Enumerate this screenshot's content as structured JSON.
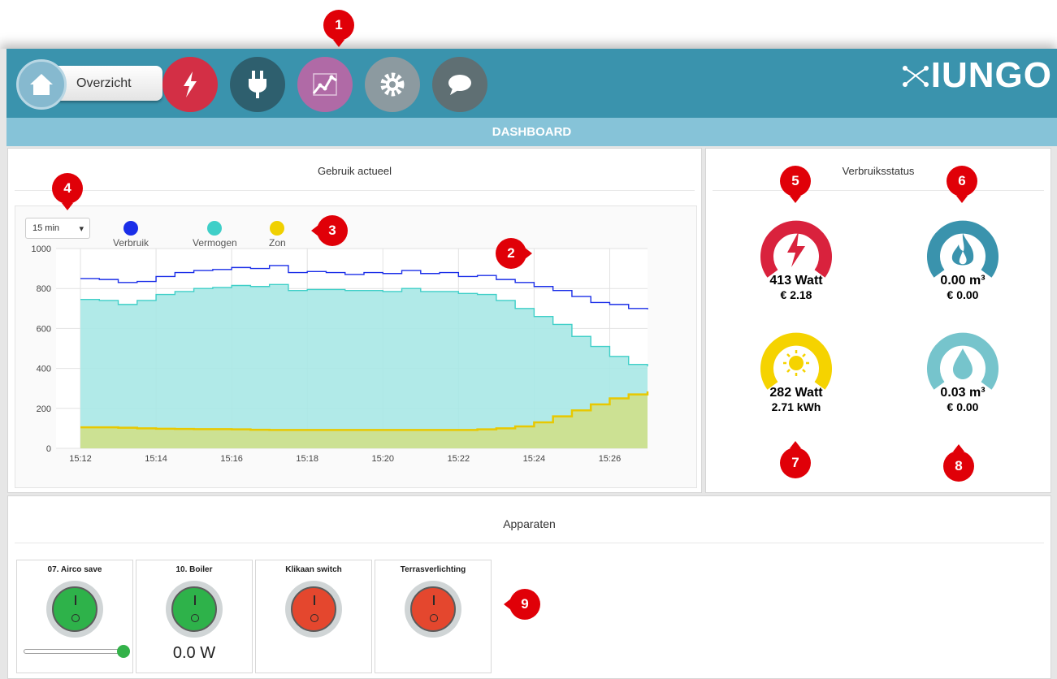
{
  "nav": {
    "overview_label": "Overzicht",
    "buttons": [
      {
        "name": "energy",
        "icon": "lightning-icon",
        "color": "#d32f45"
      },
      {
        "name": "plug",
        "icon": "plug-icon",
        "color": "#2e5f6e"
      },
      {
        "name": "chart",
        "icon": "chart-icon",
        "color": "#b06aa6"
      },
      {
        "name": "settings",
        "icon": "gear-icon",
        "color": "#8c9aa0"
      },
      {
        "name": "messages",
        "icon": "chat-icon",
        "color": "#5f6f73"
      }
    ],
    "brand": "IUNGO"
  },
  "dashboard": {
    "title": "DASHBOARD"
  },
  "usage": {
    "title": "Gebruik actueel",
    "period": "15 min",
    "legend": [
      {
        "label": "Verbruik",
        "color": "#1a2ee8"
      },
      {
        "label": "Vermogen",
        "color": "#3fcfc8"
      },
      {
        "label": "Zon",
        "color": "#f0d000"
      }
    ]
  },
  "chart_data": {
    "type": "area",
    "x_ticks": [
      "15:12",
      "15:14",
      "15:16",
      "15:18",
      "15:20",
      "15:22",
      "15:24",
      "15:26"
    ],
    "y_ticks": [
      "0",
      "200",
      "400",
      "600",
      "800",
      "1000"
    ],
    "ylim": [
      0,
      1000
    ],
    "series": [
      {
        "name": "Verbruik",
        "color": "#1a2ee8",
        "x": [
          0,
          0.5,
          1,
          1.5,
          2,
          2.5,
          3,
          3.5,
          4,
          4.5,
          5,
          5.5,
          6,
          6.5,
          7,
          7.5,
          8,
          8.5,
          9,
          9.5,
          10,
          10.5,
          11,
          11.5,
          12,
          12.5,
          13,
          13.5,
          14,
          14.5,
          15
        ],
        "values": [
          850,
          845,
          830,
          835,
          860,
          880,
          890,
          895,
          905,
          900,
          915,
          880,
          885,
          880,
          870,
          880,
          875,
          890,
          875,
          880,
          860,
          865,
          845,
          830,
          810,
          790,
          760,
          730,
          720,
          700,
          695
        ]
      },
      {
        "name": "Vermogen",
        "color": "#3fcfc8",
        "x": [
          0,
          0.5,
          1,
          1.5,
          2,
          2.5,
          3,
          3.5,
          4,
          4.5,
          5,
          5.5,
          6,
          6.5,
          7,
          7.5,
          8,
          8.5,
          9,
          9.5,
          10,
          10.5,
          11,
          11.5,
          12,
          12.5,
          13,
          13.5,
          14,
          14.5,
          15
        ],
        "values": [
          745,
          740,
          720,
          740,
          770,
          785,
          800,
          805,
          815,
          810,
          820,
          790,
          795,
          795,
          790,
          790,
          785,
          800,
          785,
          785,
          775,
          770,
          740,
          700,
          660,
          620,
          560,
          510,
          460,
          420,
          410
        ]
      },
      {
        "name": "Zon",
        "color": "#e8c800",
        "x": [
          0,
          0.5,
          1,
          1.5,
          2,
          2.5,
          3,
          3.5,
          4,
          4.5,
          5,
          5.5,
          6,
          6.5,
          7,
          7.5,
          8,
          8.5,
          9,
          9.5,
          10,
          10.5,
          11,
          11.5,
          12,
          12.5,
          13,
          13.5,
          14,
          14.5,
          15
        ],
        "values": [
          105,
          105,
          103,
          100,
          98,
          97,
          96,
          96,
          95,
          93,
          92,
          92,
          92,
          92,
          92,
          92,
          92,
          92,
          92,
          92,
          92,
          95,
          100,
          110,
          130,
          160,
          190,
          220,
          250,
          270,
          285
        ]
      }
    ]
  },
  "status": {
    "title": "Verbruiksstatus",
    "gauges": [
      {
        "icon": "lightning-icon",
        "color": "#d9223d",
        "value": "413 Watt",
        "sub": "€ 2.18"
      },
      {
        "icon": "flame-icon",
        "color": "#3a93ad",
        "value": "0.00 m³",
        "sub": "€ 0.00"
      },
      {
        "icon": "sun-icon",
        "color": "#f5d300",
        "value": "282 Watt",
        "sub": "2.71 kWh"
      },
      {
        "icon": "drop-icon",
        "color": "#76c4cc",
        "value": "0.03 m³",
        "sub": "€ 0.00"
      }
    ]
  },
  "devices": {
    "title": "Apparaten",
    "items": [
      {
        "name": "07. Airco save",
        "state": "on",
        "color": "#2eb24a",
        "slider_level": 1.0
      },
      {
        "name": "10. Boiler",
        "state": "on",
        "color": "#2eb24a",
        "power": "0.0 W"
      },
      {
        "name": "Klikaan switch",
        "state": "off",
        "color": "#e4472e"
      },
      {
        "name": "Terrasverlichting",
        "state": "off",
        "color": "#e4472e"
      }
    ]
  },
  "markers": [
    "1",
    "2",
    "3",
    "4",
    "5",
    "6",
    "7",
    "8",
    "9"
  ]
}
